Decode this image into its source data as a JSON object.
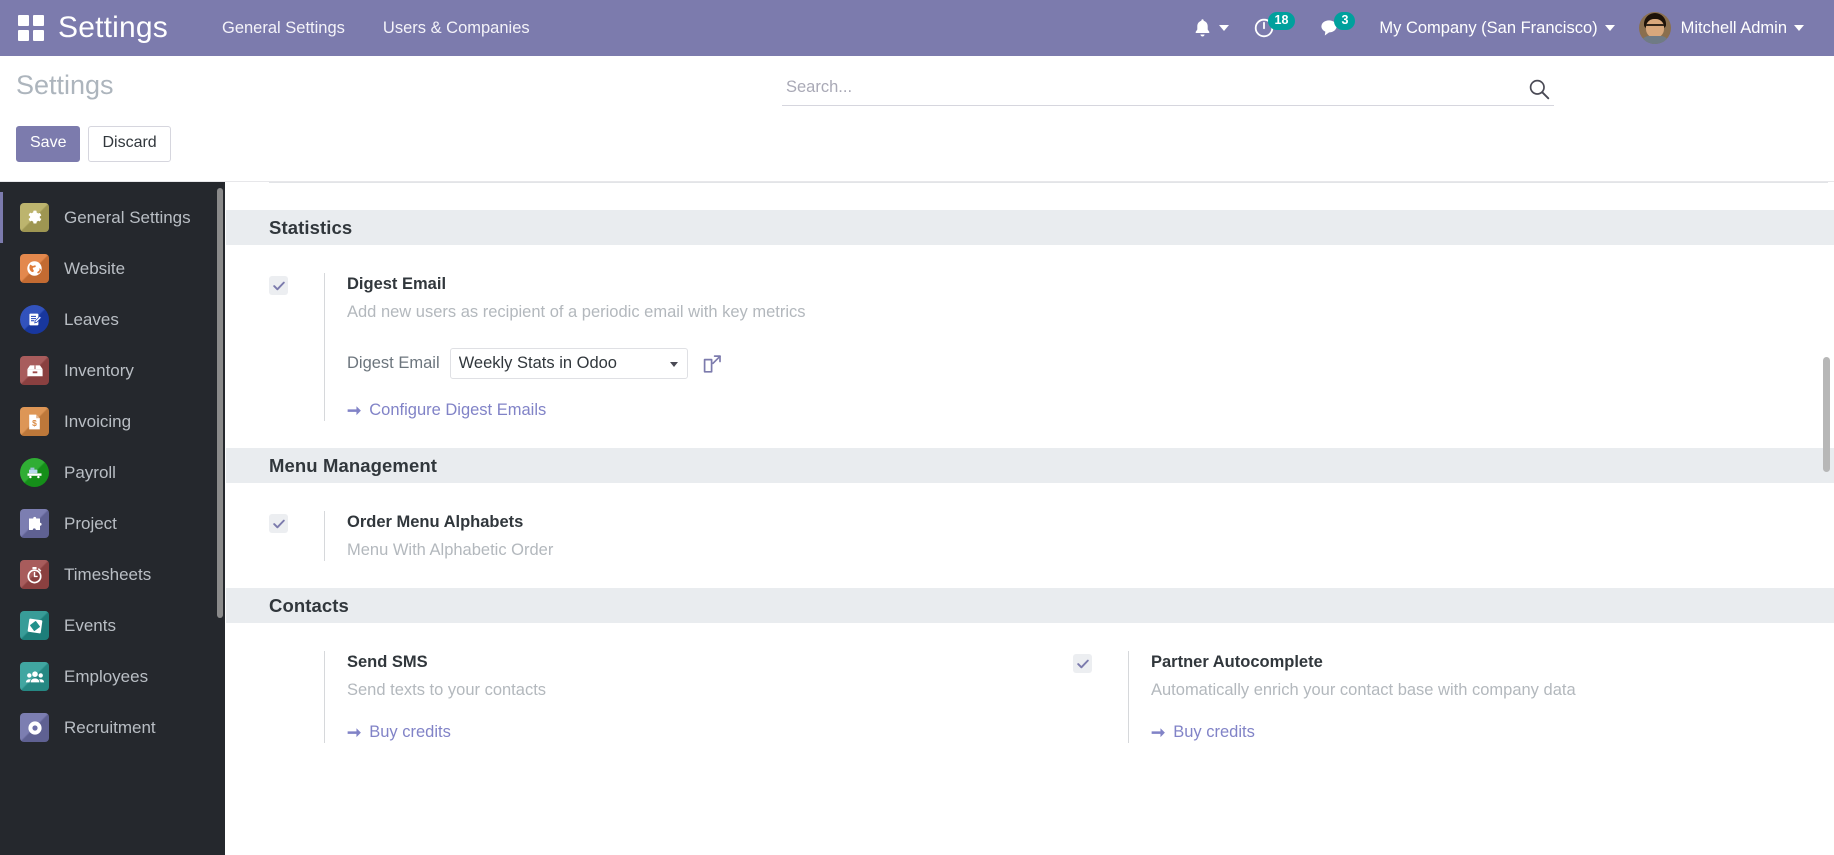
{
  "navbar": {
    "apps_icon": "apps-grid-icon",
    "brand": "Settings",
    "menu": [
      {
        "label": "General Settings"
      },
      {
        "label": "Users & Companies"
      }
    ],
    "activity_icon": "bell-icon",
    "messaging_count_icon": "clock-icon",
    "messaging_count": "18",
    "chat_icon": "chat-bubble-icon",
    "chat_count": "3",
    "company": "My Company (San Francisco)",
    "user": "Mitchell Admin"
  },
  "control_panel": {
    "breadcrumb": "Settings",
    "save_label": "Save",
    "discard_label": "Discard",
    "search_placeholder": "Search...",
    "search_value": "",
    "search_icon": "magnifier-icon"
  },
  "sidebar": {
    "items": [
      {
        "label": "General Settings",
        "icon": "gear-icon",
        "color": "#b5ac5e",
        "shape": "square",
        "active": true
      },
      {
        "label": "Website",
        "icon": "globe-icon",
        "color": "#e07b39",
        "shape": "square",
        "active": false
      },
      {
        "label": "Leaves",
        "icon": "notepad-pencil-icon",
        "color": "#1b3fb5",
        "shape": "round",
        "active": false
      },
      {
        "label": "Inventory",
        "icon": "box-icon",
        "color": "#9e4a4a",
        "shape": "square",
        "active": false
      },
      {
        "label": "Invoicing",
        "icon": "invoice-dollar-icon",
        "color": "#d98a43",
        "shape": "square",
        "active": false
      },
      {
        "label": "Payroll",
        "icon": "payroll-icon",
        "color": "#18a41d",
        "shape": "round",
        "active": false
      },
      {
        "label": "Project",
        "icon": "puzzle-icon",
        "color": "#6d6fa8",
        "shape": "square",
        "active": false
      },
      {
        "label": "Timesheets",
        "icon": "stopwatch-icon",
        "color": "#9e4a4a",
        "shape": "square",
        "active": false
      },
      {
        "label": "Events",
        "icon": "diamond-ticket-icon",
        "color": "#21918c",
        "shape": "square",
        "active": false
      },
      {
        "label": "Employees",
        "icon": "people-icon",
        "color": "#2b9c96",
        "shape": "square",
        "active": false
      },
      {
        "label": "Recruitment",
        "icon": "recruitment-icon",
        "color": "#6d6fa8",
        "shape": "square",
        "active": false
      }
    ]
  },
  "settings": {
    "sections": [
      {
        "title": "Statistics",
        "left": {
          "checked": true,
          "label": "Digest Email",
          "description": "Add new users as recipient of a periodic email with key metrics",
          "field": {
            "label": "Digest Email",
            "value": "Weekly Stats in Odoo",
            "external_icon": "external-link-icon"
          },
          "link": "Configure Digest Emails"
        }
      },
      {
        "title": "Menu Management",
        "left": {
          "checked": true,
          "label": "Order Menu Alphabets",
          "description": "Menu With Alphabetic Order"
        }
      },
      {
        "title": "Contacts",
        "left": {
          "checked": false,
          "label": "Send SMS",
          "description": "Send texts to your contacts",
          "link": "Buy credits"
        },
        "right": {
          "checked": true,
          "label": "Partner Autocomplete",
          "description": "Automatically enrich your contact base with company data",
          "link": "Buy credits"
        }
      }
    ]
  },
  "colors": {
    "brand_purple": "#7c7bad",
    "badge_teal": "#00a09d",
    "sidebar_dark": "#25282d",
    "section_band": "#e9ecef",
    "link_purple": "#8183c7"
  }
}
